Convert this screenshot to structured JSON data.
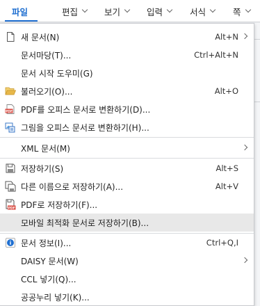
{
  "menubar": {
    "tabs": [
      {
        "label": "파일",
        "active": true
      },
      {
        "label": "편집",
        "active": false
      },
      {
        "label": "보기",
        "active": false
      },
      {
        "label": "입력",
        "active": false
      },
      {
        "label": "서식",
        "active": false
      },
      {
        "label": "쪽",
        "active": false
      }
    ]
  },
  "menu": {
    "items": [
      {
        "label": "새 문서(N)",
        "shortcut": "Alt+N",
        "icon": "new-document-icon",
        "submenu": true
      },
      {
        "label": "문서마당(T)...",
        "shortcut": "Ctrl+Alt+N",
        "icon": "",
        "submenu": false
      },
      {
        "label": "문서 시작 도우미(G)",
        "shortcut": "",
        "icon": "",
        "submenu": false
      },
      {
        "label": "불러오기(O)...",
        "shortcut": "Alt+O",
        "icon": "folder-open-icon",
        "submenu": false
      },
      {
        "label": "PDF를 오피스 문서로 변환하기(D)...",
        "shortcut": "",
        "icon": "pdf-convert-icon",
        "submenu": false
      },
      {
        "label": "그림을 오피스 문서로 변환하기(H)...",
        "shortcut": "",
        "icon": "image-convert-icon",
        "submenu": false
      },
      {
        "label": "XML 문서(M)",
        "shortcut": "",
        "icon": "",
        "submenu": true
      },
      {
        "label": "저장하기(S)",
        "shortcut": "Alt+S",
        "icon": "save-icon",
        "submenu": false
      },
      {
        "label": "다른 이름으로 저장하기(A)...",
        "shortcut": "Alt+V",
        "icon": "save-as-icon",
        "submenu": false
      },
      {
        "label": "PDF로 저장하기(F)...",
        "shortcut": "",
        "icon": "save-pdf-icon",
        "submenu": false
      },
      {
        "label": "모바일 최적화 문서로 저장하기(B)...",
        "shortcut": "",
        "icon": "",
        "submenu": false,
        "highlighted": true
      },
      {
        "label": "문서 정보(I)...",
        "shortcut": "Ctrl+Q,I",
        "icon": "info-icon",
        "submenu": false
      },
      {
        "label": "DAISY 문서(W)",
        "shortcut": "",
        "icon": "",
        "submenu": true
      },
      {
        "label": "CCL 넣기(Q)...",
        "shortcut": "",
        "icon": "",
        "submenu": false
      },
      {
        "label": "공공누리 넣기(K)...",
        "shortcut": "",
        "icon": "",
        "submenu": false
      }
    ]
  },
  "colors": {
    "accent": "#1f6fd0",
    "highlight": "#e8e8e8",
    "folder": "#e8b84a",
    "pdf_red": "#d9463c"
  }
}
